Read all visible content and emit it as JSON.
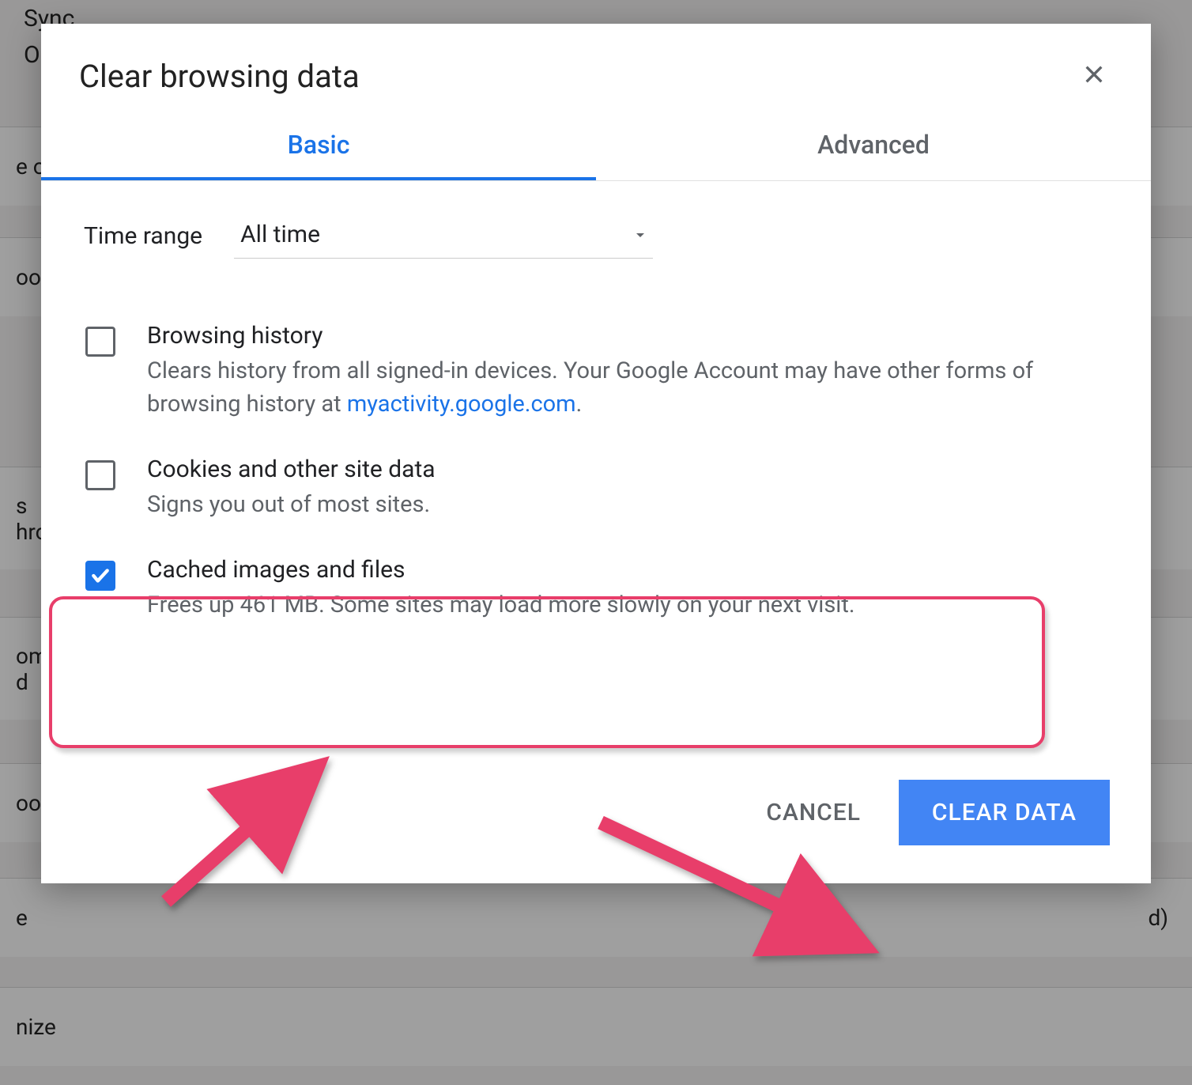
{
  "dialog": {
    "title": "Clear browsing data",
    "tabs": {
      "basic": "Basic",
      "advanced": "Advanced"
    },
    "timeRange": {
      "label": "Time range",
      "value": "All time"
    },
    "options": {
      "browsingHistory": {
        "title": "Browsing history",
        "descPrefix": "Clears history from all signed-in devices. Your Google Account may have other forms of browsing history at ",
        "link": "myactivity.google.com",
        "descSuffix": ".",
        "checked": false
      },
      "cookies": {
        "title": "Cookies and other site data",
        "desc": "Signs you out of most sites.",
        "checked": false
      },
      "cached": {
        "title": "Cached images and files",
        "desc": "Frees up 461 MB. Some sites may load more slowly on your next visit.",
        "checked": true
      }
    },
    "buttons": {
      "cancel": "CANCEL",
      "clear": "CLEAR DATA"
    }
  },
  "background": {
    "sync": "Sync",
    "row1": "O",
    "row2": "e otl",
    "row3": "ooo",
    "row4": "s",
    "row4b": "hro",
    "row5": "ome",
    "row5b": "d",
    "row6": "ook",
    "row7": "e",
    "row7b": "d)",
    "row8": "nize"
  }
}
